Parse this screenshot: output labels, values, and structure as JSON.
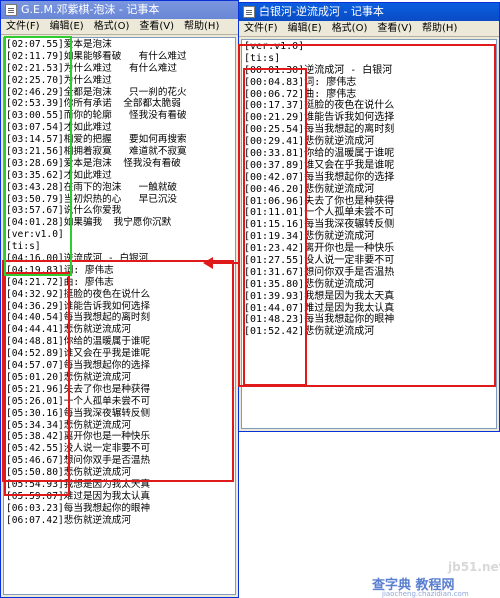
{
  "left_window": {
    "title": "G.E.M.邓紫棋-泡沫 - 记事本",
    "menu": [
      "文件(F)",
      "编辑(E)",
      "格式(O)",
      "查看(V)",
      "帮助(H)"
    ],
    "lines": [
      "[02:07.55]爱本是泡沫",
      "[02:11.79]如果能够看破   有什么难过",
      "[02:21.53]为什么难过   有什么难过",
      "[02:25.70]为什么难过",
      "[02:46.29]全都是泡沫   只一刹的花火",
      "[02:53.39]你所有承诺  全部都太脆弱",
      "[03:00.55]而你的轮廓   怪我没有看破",
      "[03:07.54]才如此难过",
      "[03:14.57]相爱的把握   要如何再搜索",
      "[03:21.56]相拥着寂寞   难道就不寂寞",
      "[03:28.69]爱本是泡沫  怪我没有看破",
      "[03:35.62]才如此难过",
      "[03:43.28]在雨下的泡沫   一触就破",
      "[03:50.79]当初炽热的心   早已沉没",
      "[03:57.67]说什么你爱我",
      "[04:01.28]如果骗我  我宁愿你沉默",
      "[ver:v1.0]",
      "[ti:s]",
      "[04:16.00]逆流成河 - 白银河",
      "[04:19.83]词: 廖伟志",
      "[04:21.72]曲: 廖伟志",
      "[04:32.92]挺脸的夜色在说什么",
      "[04:36.29]谁能告诉我如何选择",
      "[04:40.54]每当我想起的离时刻",
      "[04:44.41]悲伤就逆流成河",
      "[04:48.81]你给的温暖属于谁呢",
      "[04:52.89]谁又会在乎我是谁呢",
      "[04:57.07]每当我想起你的选择",
      "[05:01.20]悲伤就逆流成河",
      "[05:21.96]失去了你也是种获得",
      "[05:26.01]一个人孤单未尝不可",
      "[05:30.16]每当我深夜辗转反侧",
      "[05:34.34]悲伤就逆流成河",
      "[05:38.42]离开你也是一种快乐",
      "[05:42.55]没人说一定非要不可",
      "[05:46.67]想问你双手是否温热",
      "[05:50.80]悲伤就逆流成河",
      "[05:54.93]我想是因为我太天真",
      "[05:59.07]难过是因为我太认真",
      "[06:03.23]每当我想起你的眼神",
      "[06:07.42]悲伤就逆流成河"
    ]
  },
  "right_window": {
    "title": "白银河-逆流成河 - 记事本",
    "menu": [
      "文件(F)",
      "编辑(E)",
      "格式(O)",
      "查看(V)",
      "帮助(H)"
    ],
    "lines": [
      "[ver:v1.0]",
      "[ti:s]",
      "[00:01.30]逆流成河 - 白银河",
      "[00:04.83]词: 廖伟志",
      "[00:06.72]曲: 廖伟志",
      "[00:17.37]挺脸的夜色在说什么",
      "[00:21.29]谁能告诉我如何选择",
      "[00:25.54]每当我想起的离时刻",
      "[00:29.41]悲伤就逆流成河",
      "[00:33.81]你给的温暖属于谁呢",
      "[00:37.89]谁又会在乎我是谁呢",
      "[00:42.07]每当我想起你的选择",
      "[00:46.20]悲伤就逆流成河",
      "[01:06.96]失去了你也是种获得",
      "[01:11.01]一个人孤单未尝不可",
      "[01:15.16]每当我深夜辗转反侧",
      "[01:19.34]悲伤就逆流成河",
      "[01:23.42]离开你也是一种快乐",
      "[01:27.55]没人说一定非要不可",
      "[01:31.67]想问你双手是否温热",
      "[01:35.80]悲伤就逆流成河",
      "[01:39.93]我想是因为我太天真",
      "[01:44.07]难过是因为我太认真",
      "[01:48.23]每当我想起你的眼神",
      "[01:52.42]悲伤就逆流成河"
    ]
  },
  "watermark": {
    "site": "jb51.net",
    "brand": "查字典 教程网",
    "url": "jiaocheng.chazidian.com"
  },
  "colors": {
    "highlight_red": "#e01a1a",
    "highlight_green": "#2ecc2e",
    "title_active": "#0a5fe0",
    "title_inactive": "#7a96df"
  }
}
